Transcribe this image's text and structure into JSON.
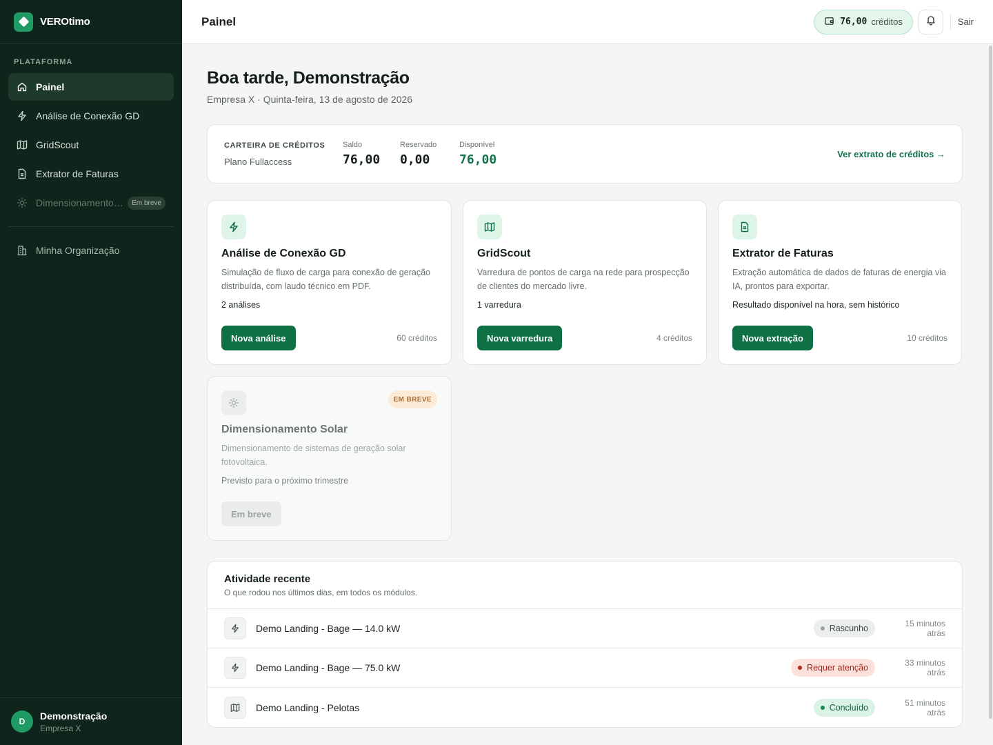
{
  "brand": {
    "name": "VEROtimo"
  },
  "sidebar": {
    "section_label": "PLATAFORMA",
    "items": [
      {
        "label": "Painel",
        "icon": "home-icon"
      },
      {
        "label": "Análise de Conexão GD",
        "icon": "bolt-icon"
      },
      {
        "label": "GridScout",
        "icon": "map-icon"
      },
      {
        "label": "Extrator de Faturas",
        "icon": "document-icon"
      },
      {
        "label": "Dimensionamento Solar",
        "icon": "sun-icon",
        "badge": "Em breve"
      }
    ],
    "org_item": {
      "label": "Minha Organização",
      "icon": "building-icon"
    },
    "user": {
      "initial": "D",
      "name": "Demonstração",
      "org": "Empresa X"
    }
  },
  "header": {
    "title": "Painel",
    "credits_value": "76,00",
    "credits_unit": "créditos",
    "logout": "Sair"
  },
  "main": {
    "greeting": "Boa tarde, Demonstração",
    "subline": "Empresa X · Quinta-feira, 13 de agosto de 2026",
    "wallet": {
      "title": "CARTEIRA DE CRÉDITOS",
      "plan": "Plano Fullaccess",
      "saldo_label": "Saldo",
      "saldo_value": "76,00",
      "reservado_label": "Reservado",
      "reservado_value": "0,00",
      "disponivel_label": "Disponível",
      "disponivel_value": "76,00",
      "link": "Ver extrato de créditos →"
    },
    "cards": [
      {
        "title": "Análise de Conexão GD",
        "desc": "Simulação de fluxo de carga para conexão de geração distribuída, com laudo técnico em PDF.",
        "meta": "2 análises",
        "button": "Nova análise",
        "cost": "60 créditos"
      },
      {
        "title": "GridScout",
        "desc": "Varredura de pontos de carga na rede para prospecção de clientes do mercado livre.",
        "meta": "1 varredura",
        "button": "Nova varredura",
        "cost": "4 créditos"
      },
      {
        "title": "Extrator de Faturas",
        "desc": "Extração automática de dados de faturas de energia via IA, prontos para exportar.",
        "meta": "Resultado disponível na hora, sem histórico",
        "button": "Nova extração",
        "cost": "10 créditos"
      },
      {
        "title": "Dimensionamento Solar",
        "desc": "Dimensionamento de sistemas de geração solar fotovoltaica.",
        "meta": "Previsto para o próximo trimestre",
        "button": "Em breve",
        "badge": "EM BREVE"
      }
    ],
    "activity": {
      "title": "Atividade recente",
      "subtitle": "O que rodou nos últimos dias, em todos os módulos.",
      "rows": [
        {
          "name": "Demo Landing - Bage — 14.0 kW",
          "icon": "bolt-icon",
          "status": "Rascunho",
          "time": "15 minutos atrás"
        },
        {
          "name": "Demo Landing - Bage — 75.0 kW",
          "icon": "bolt-icon",
          "status": "Requer atenção",
          "time": "33 minutos atrás"
        },
        {
          "name": "Demo Landing - Pelotas",
          "icon": "map-icon",
          "status": "Concluído",
          "time": "51 minutos atrás"
        }
      ]
    }
  },
  "colors": {
    "sidebar_bg": "#0f241a",
    "accent": "#0f7046",
    "accent_light": "#def4e7"
  }
}
